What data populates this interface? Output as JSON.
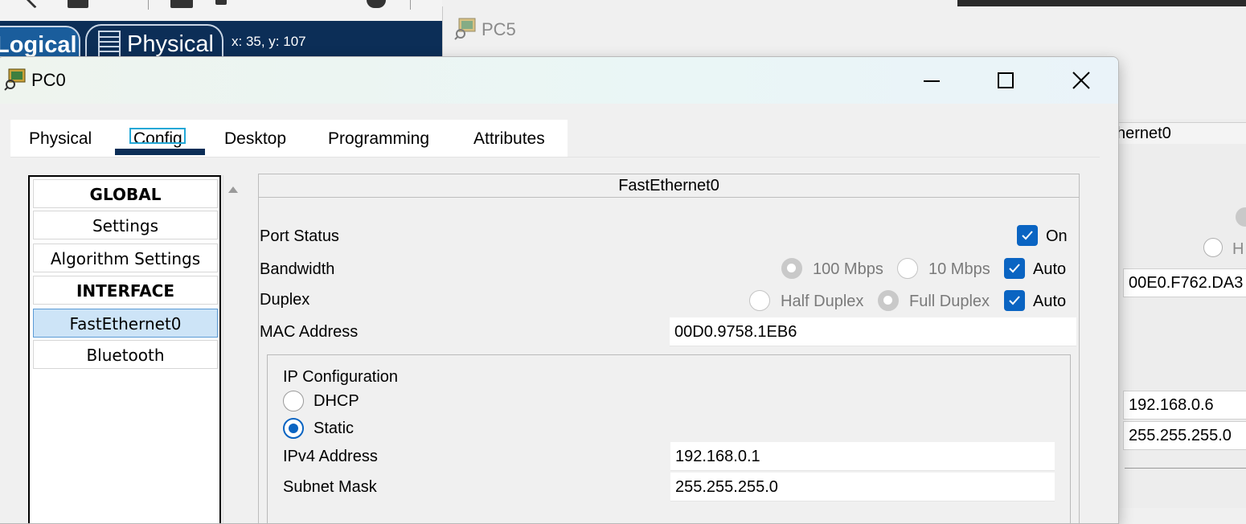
{
  "workspace": {
    "tab_logical": "Logical",
    "tab_physical": "Physical",
    "coordinates": "x: 35, y: 107"
  },
  "pc5": {
    "title": "PC5",
    "header_partial": "hernet0",
    "mac_partial": "00E0.F762.DA3",
    "ip_partial": "192.168.0.6",
    "mask_partial": "255.255.255.0",
    "radio_partial": "H"
  },
  "pc0": {
    "title": "PC0",
    "tabs": [
      "Physical",
      "Config",
      "Desktop",
      "Programming",
      "Attributes"
    ],
    "active_tab": "Config",
    "left_list": [
      {
        "label": "GLOBAL",
        "type": "header"
      },
      {
        "label": "Settings",
        "type": "item"
      },
      {
        "label": "Algorithm Settings",
        "type": "item"
      },
      {
        "label": "INTERFACE",
        "type": "header"
      },
      {
        "label": "FastEthernet0",
        "type": "item",
        "selected": true
      },
      {
        "label": "Bluetooth",
        "type": "item"
      }
    ],
    "interface": {
      "title": "FastEthernet0",
      "port_status_label": "Port Status",
      "port_on_label": "On",
      "bandwidth_label": "Bandwidth",
      "bw_100": "100 Mbps",
      "bw_10": "10 Mbps",
      "bw_auto": "Auto",
      "duplex_label": "Duplex",
      "half_duplex": "Half Duplex",
      "full_duplex": "Full Duplex",
      "duplex_auto": "Auto",
      "mac_label": "MAC Address",
      "mac_value": "00D0.9758.1EB6",
      "ip_config_label": "IP Configuration",
      "dhcp_label": "DHCP",
      "static_label": "Static",
      "ipv4_label": "IPv4 Address",
      "ipv4_value": "192.168.0.1",
      "subnet_label": "Subnet Mask",
      "subnet_value": "255.255.255.0"
    }
  },
  "colors": {
    "accent_blue": "#0a64c2",
    "workspace_bar": "#0c2e57",
    "selected_item": "#cde4f7"
  }
}
